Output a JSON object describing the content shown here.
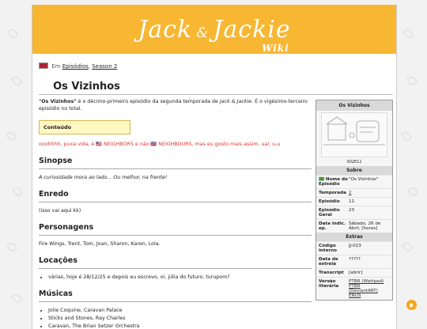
{
  "header": {
    "logo_main": "Jack",
    "logo_amp": "&",
    "logo_second": "Jackie",
    "logo_sub": "Wiki"
  },
  "breadcrumb": {
    "prefix": "Em",
    "links": [
      "Episódios",
      "Season 2"
    ]
  },
  "page_title": "Os Vizinhos",
  "intro": {
    "bold": "\"Os Vizinhos\"",
    "text1": " é o décimo-primeiro episódio da segunda temporada de ",
    "italic": "Jack & Jackie",
    "text2": ". É o vigésimo-terceiro episódio no total."
  },
  "toc_label": "Conteúdo",
  "red_note": "ooohhhh, puxa vida, é 🇺🇸 NEIGHBORS e não 🇬🇧 NEIGHBOURS, mas eu gosto mais assim, ual. u-u",
  "sections": {
    "sinopse": {
      "heading": "Sinopse",
      "text": "A curiosidade mora ao lado... Ou melhor, na frente!"
    },
    "enredo": {
      "heading": "Enredo",
      "text": "(isso vai aqui kk)"
    },
    "personagens": {
      "heading": "Personagens",
      "text": "Fire Wings, Trent, Tom, Joan, Sharon, Karen, Lola."
    },
    "locacoes": {
      "heading": "Locações",
      "items": [
        "várias, hoje é 28/12/25 e depois eu escrevo, oi, júlia do futuro, turupom?"
      ]
    },
    "musicas": {
      "heading": "Músicas",
      "items": [
        "Jolie Coquine, Caravan Palace",
        "Sticks and Stones, Ray Charles",
        "Caravan, The Brian Setzer Orchestra"
      ]
    }
  },
  "infobox": {
    "title": "Os Vizinhos",
    "caption": "S02E11",
    "section_about": "Sobre",
    "about": [
      {
        "key": "🇧🇷 Nome do Episódio",
        "value": "\"Os Vizinhos\""
      },
      {
        "key": "Temporada",
        "value": "2"
      },
      {
        "key": "Episódio",
        "value": "11"
      },
      {
        "key": "Episódio Geral",
        "value": "23"
      },
      {
        "key": "Data indic. ep.",
        "value": "Sábado, 26 de Abril, [horas]"
      }
    ],
    "section_extras": "Extras",
    "extras": [
      {
        "key": "Código interno",
        "value": "JJ-023"
      },
      {
        "key": "Data de estreia",
        "value": "?????"
      },
      {
        "key": "Transcript",
        "value": "[abrir]"
      },
      {
        "key": "Versão literária",
        "value_links": [
          "PTBR (Wattpad)",
          "PTBR (DeviantART)",
          "ENUS"
        ]
      }
    ]
  },
  "colors": {
    "banner": "#f8b732",
    "accent_red": "#d33333",
    "toc_bg": "#fff7c2"
  },
  "icons": {
    "theme_toggle": "moon-icon"
  }
}
